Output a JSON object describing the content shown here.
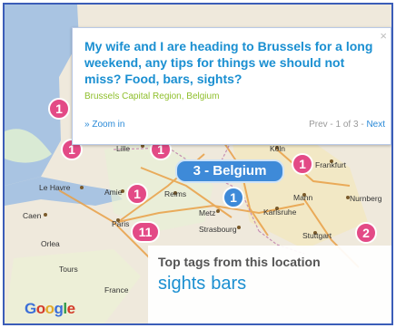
{
  "popup": {
    "question": "My wife and I are heading to Brussels for a long weekend, any tips for things we should not miss? Food, bars, sights?",
    "region": "Brussels Capital Region, Belgium",
    "zoom_link": "» Zoom in",
    "prev_label": "Prev",
    "counter": "1 of 3",
    "next_label": "Next",
    "close_glyph": "×"
  },
  "map": {
    "cities": [
      "Lille",
      "Köln",
      "Frankfurt",
      "Le Havre",
      "Amie",
      "Reims",
      "Nurnberg",
      "Mann",
      "Caen",
      "Paris",
      "Metz",
      "Karlsruhe",
      "Strasbourg",
      "Stuttgart",
      "Orlea",
      "France",
      "Tours"
    ],
    "cluster_label": "3 - Belgium",
    "markers": [
      {
        "label": "1",
        "color": "#e34a86"
      },
      {
        "label": "1",
        "color": "#e34a86"
      },
      {
        "label": "1",
        "color": "#e34a86"
      },
      {
        "label": "1",
        "color": "#e34a86"
      },
      {
        "label": "1",
        "color": "#e34a86"
      },
      {
        "label": "11",
        "color": "#e34a86"
      },
      {
        "label": "2",
        "color": "#e34a86"
      },
      {
        "label": "1",
        "color": "#3e8ad8"
      }
    ],
    "water_color": "#a9c4e2",
    "land_color": "#efe9dc"
  },
  "tags": {
    "heading": "Top tags from this location",
    "items": [
      "sights",
      "bars"
    ]
  },
  "logo": {
    "letters": [
      "G",
      "o",
      "o",
      "g",
      "l",
      "e"
    ],
    "colors": [
      "#3c6fd8",
      "#d43b2a",
      "#e2a92b",
      "#3c6fd8",
      "#2f9a47",
      "#d43b2a"
    ]
  },
  "colors": {
    "frame_border": "#3b5db8",
    "accent": "#1a8fd1"
  }
}
